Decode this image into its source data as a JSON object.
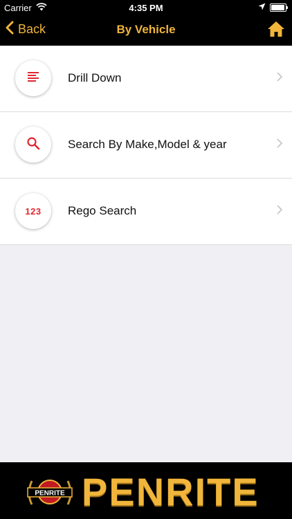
{
  "status_bar": {
    "carrier": "Carrier",
    "time": "4:35 PM"
  },
  "nav": {
    "back_label": "Back",
    "title": "By Vehicle"
  },
  "menu": {
    "items": [
      {
        "label": "Drill Down",
        "icon": "list-icon"
      },
      {
        "label": "Search By Make,Model & year",
        "icon": "search-icon"
      },
      {
        "label": "Rego Search",
        "icon": "numbers-icon",
        "icon_text": "123"
      }
    ]
  },
  "footer": {
    "badge_text": "PENRITE",
    "wordmark": "PENRITE"
  },
  "colors": {
    "accent": "#f0b53a",
    "icon_red": "#e02630",
    "bar_bg": "#000000",
    "page_bg": "#efeff4"
  }
}
